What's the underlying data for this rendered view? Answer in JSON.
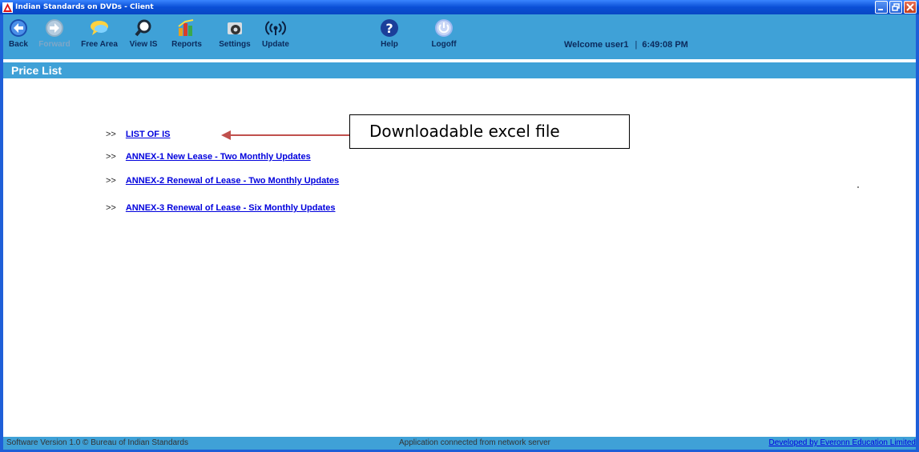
{
  "window": {
    "title": "Indian Standards on DVDs - Client"
  },
  "toolbar": {
    "buttons": [
      {
        "label": "Back",
        "icon": "back-arrow-icon"
      },
      {
        "label": "Forward",
        "icon": "forward-arrow-icon"
      },
      {
        "label": "Free Area",
        "icon": "chat-bubble-icon"
      },
      {
        "label": "View IS",
        "icon": "magnifier-icon"
      },
      {
        "label": "Reports",
        "icon": "bar-chart-icon"
      },
      {
        "label": "Settings",
        "icon": "gear-icon"
      },
      {
        "label": "Update",
        "icon": "wireless-icon"
      },
      {
        "label": "Help",
        "icon": "help-icon"
      },
      {
        "label": "Logoff",
        "icon": "power-icon"
      }
    ],
    "welcome": "Welcome",
    "user": "user1",
    "separator": "|",
    "time": "6:49:08 PM"
  },
  "page": {
    "title": "Price List"
  },
  "links": [
    {
      "bullet": ">>",
      "label": "LIST OF IS"
    },
    {
      "bullet": ">>",
      "label": "ANNEX-1 New Lease - Two Monthly Updates"
    },
    {
      "bullet": ">>",
      "label": "ANNEX-2 Renewal of Lease - Two Monthly Updates"
    },
    {
      "bullet": ">>",
      "label": "ANNEX-3 Renewal of Lease - Six Monthly Updates"
    }
  ],
  "callout": {
    "text": "Downloadable excel file"
  },
  "status": {
    "left": "Software Version 1.0  © Bureau of Indian Standards",
    "middle": "Application connected from network server",
    "right": "Developed by Everonn Education Limited"
  },
  "colors": {
    "toolbar": "#3fa1d7",
    "titlebar": "#0a4fd6",
    "link": "#0000dd",
    "arrow": "#c0504d"
  }
}
